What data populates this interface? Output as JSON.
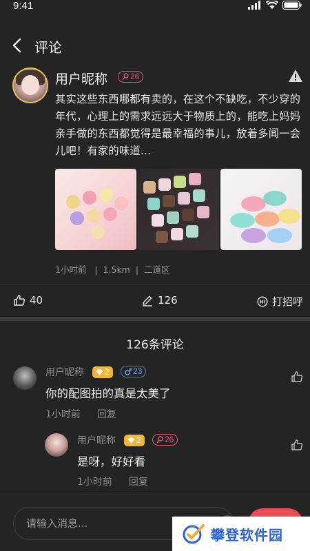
{
  "status": {
    "time": "9:41"
  },
  "nav": {
    "title": "评论"
  },
  "post": {
    "username": "用户昵称",
    "badge_value": "26",
    "text": "其实这些东西哪都有卖的，在这个不缺吃，不少穿的年代，心理上的需求远远大于物质上的，能吃上妈妈亲手做的东西都觉得是最幸福的事儿，放着多闻一会儿吧！有家的味道...",
    "meta": {
      "time": "1小时前",
      "distance": "1.5km",
      "area": "二道区"
    },
    "photos": [
      {
        "icon": "pastries-photo"
      },
      {
        "icon": "chocolate-box-photo"
      },
      {
        "icon": "macarons-photo"
      }
    ]
  },
  "actions": {
    "likes": "40",
    "comments": "126",
    "greet": "打招呼"
  },
  "comments_title": "126条评论",
  "comments": [
    {
      "username": "用户昵称",
      "level": "2",
      "gender_badge": "23",
      "text": "你的配图拍的真是太美了",
      "time": "1小时前",
      "reply": "回复"
    },
    {
      "username": "用户昵称",
      "level": "2",
      "gender_badge": "26",
      "text": "是呀，好好看",
      "time": "1小时前",
      "reply": "回复"
    }
  ],
  "input": {
    "placeholder": "请输入消息..."
  },
  "watermark": {
    "text": "攀登软件园"
  },
  "colors": {
    "background": "#242424",
    "female": "#e0566e",
    "male": "#3d84d9",
    "level": "#f4b43a",
    "send": "#ee4b55",
    "watermark": "#2a63d8"
  }
}
